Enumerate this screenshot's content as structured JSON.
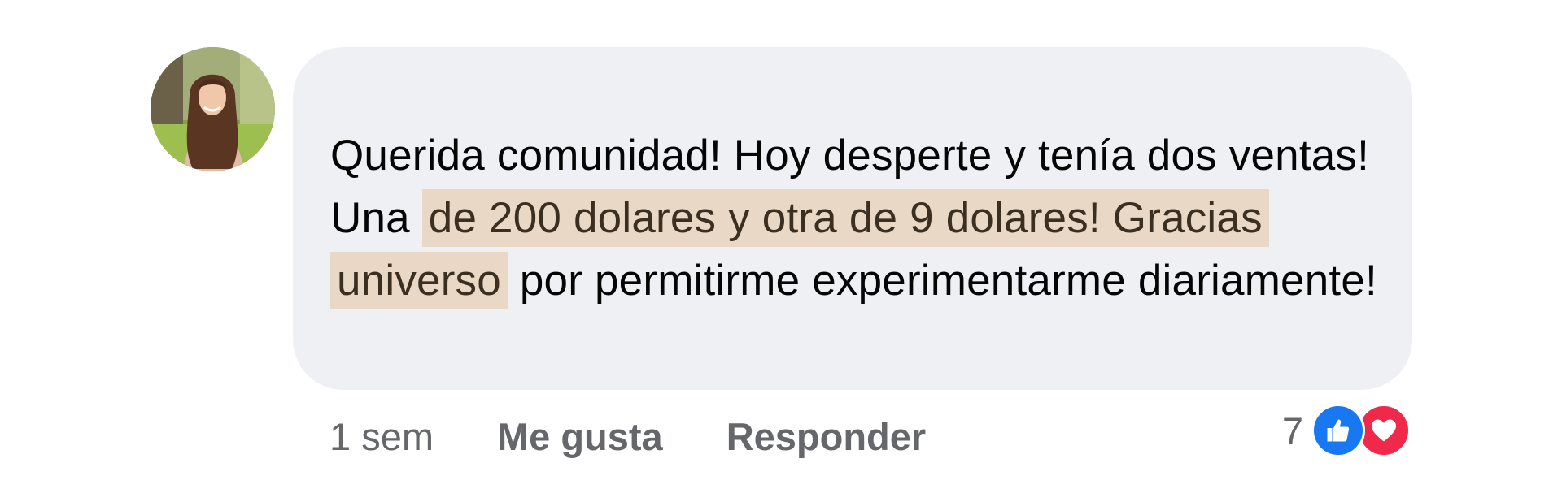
{
  "comment": {
    "text_before": "Querida comunidad! Hoy desperte y tenía dos ventas! Una ",
    "text_highlighted": "de 200 dolares y otra de 9 dolares! Gracias universo",
    "text_after": " por permitirme experimentarme diariamente!",
    "highlight_color": "#ead8c6"
  },
  "actions": {
    "time": "1 sem",
    "like_label": "Me gusta",
    "reply_label": "Responder"
  },
  "reactions": {
    "count": "7",
    "icons": [
      "thumbs-up-icon",
      "heart-icon"
    ],
    "like_color": "#1778f2",
    "love_color": "#f0284a"
  }
}
